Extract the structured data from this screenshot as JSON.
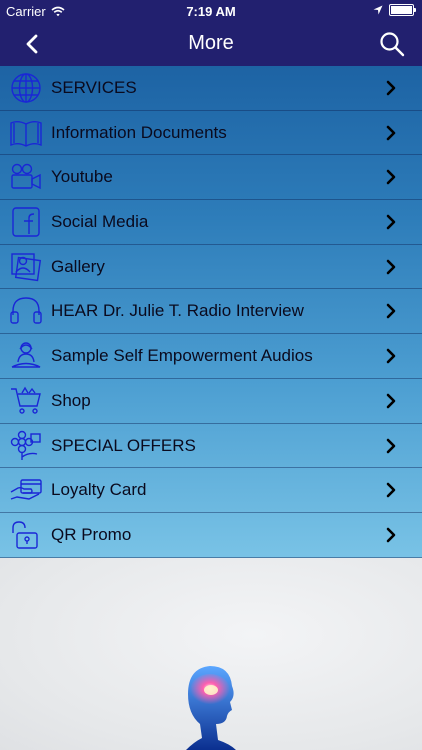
{
  "status": {
    "carrier": "Carrier",
    "time": "7:19 AM",
    "battery_level": 1.0
  },
  "nav": {
    "title": "More"
  },
  "menu": {
    "items": [
      {
        "label": "SERVICES",
        "icon": "globe-icon"
      },
      {
        "label": "Information Documents",
        "icon": "book-icon"
      },
      {
        "label": "Youtube",
        "icon": "video-camera-icon"
      },
      {
        "label": "Social Media",
        "icon": "facebook-icon"
      },
      {
        "label": "Gallery",
        "icon": "gallery-icon"
      },
      {
        "label": "HEAR Dr. Julie T. Radio Interview",
        "icon": "headphones-icon"
      },
      {
        "label": "Sample Self Empowerment Audios",
        "icon": "meditation-icon"
      },
      {
        "label": "Shop",
        "icon": "cart-icon"
      },
      {
        "label": "SPECIAL OFFERS",
        "icon": "flower-gift-icon"
      },
      {
        "label": "Loyalty Card",
        "icon": "card-hand-icon"
      },
      {
        "label": "QR Promo",
        "icon": "unlock-icon"
      }
    ]
  },
  "colors": {
    "nav": "#22206f",
    "icon": "#1a26d6",
    "text": "#0a0a1e"
  }
}
